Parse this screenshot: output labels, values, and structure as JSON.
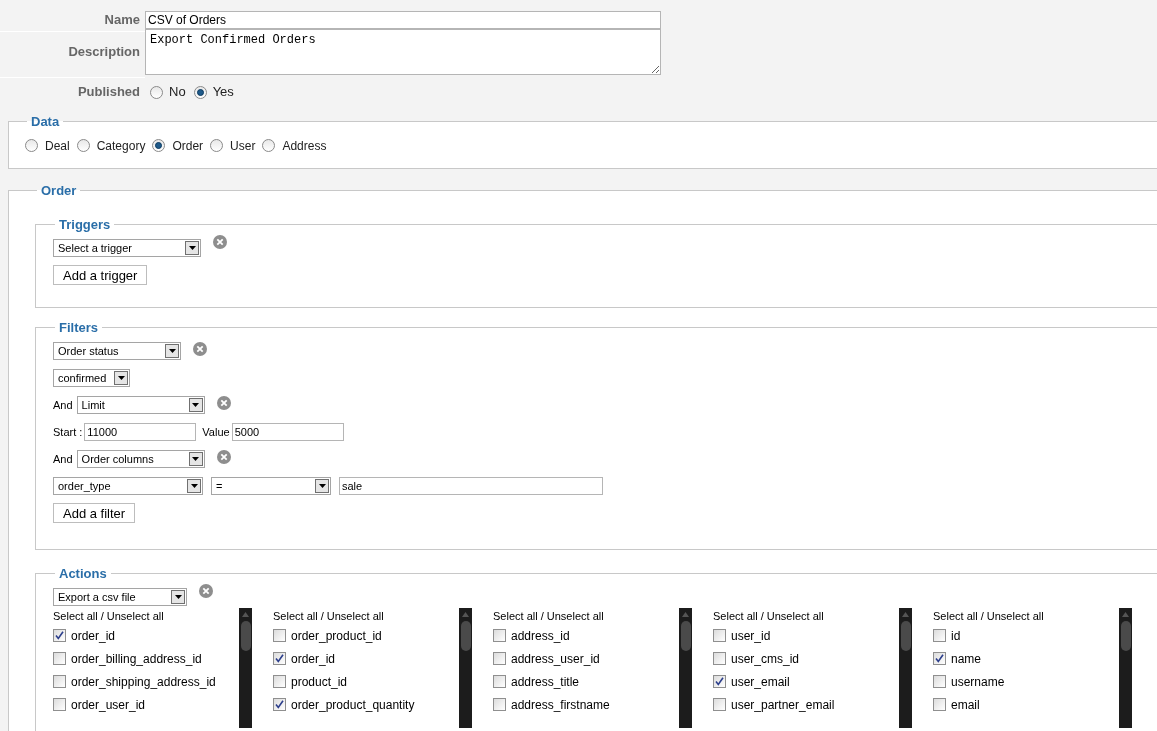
{
  "form": {
    "name": {
      "label": "Name",
      "value": "CSV of Orders"
    },
    "description": {
      "label": "Description",
      "value": "Export Confirmed Orders"
    },
    "published": {
      "label": "Published",
      "options": [
        {
          "label": "No",
          "selected": false
        },
        {
          "label": "Yes",
          "selected": true
        }
      ]
    }
  },
  "data": {
    "legend": "Data",
    "options": [
      {
        "label": "Deal",
        "selected": false
      },
      {
        "label": "Category",
        "selected": false
      },
      {
        "label": "Order",
        "selected": true
      },
      {
        "label": "User",
        "selected": false
      },
      {
        "label": "Address",
        "selected": false
      }
    ]
  },
  "order": {
    "legend": "Order",
    "triggers": {
      "legend": "Triggers",
      "select": "Select a trigger",
      "button": "Add a trigger"
    },
    "filters": {
      "legend": "Filters",
      "rows": [
        {
          "kind": "select",
          "select": "Order status",
          "removable": true
        },
        {
          "kind": "select",
          "select": "confirmed",
          "removable": false
        },
        {
          "kind": "select",
          "prefix": "And",
          "select": "Limit",
          "removable": true
        },
        {
          "kind": "range",
          "start_label": "Start :",
          "start": "11000",
          "value_label": "Value",
          "value": "5000"
        },
        {
          "kind": "select",
          "prefix": "And",
          "select": "Order columns",
          "removable": true
        },
        {
          "kind": "condition",
          "column": "order_type",
          "operator": "=",
          "value": "sale"
        }
      ],
      "button": "Add a filter"
    },
    "actions": {
      "legend": "Actions",
      "select": "Export a csv file",
      "columns": [
        {
          "select_all": "Select all / Unselect all",
          "items": [
            {
              "label": "order_id",
              "checked": true
            },
            {
              "label": "order_billing_address_id",
              "checked": false
            },
            {
              "label": "order_shipping_address_id",
              "checked": false
            },
            {
              "label": "order_user_id",
              "checked": false
            }
          ]
        },
        {
          "select_all": "Select all / Unselect all",
          "items": [
            {
              "label": "order_product_id",
              "checked": false
            },
            {
              "label": "order_id",
              "checked": true
            },
            {
              "label": "product_id",
              "checked": false
            },
            {
              "label": "order_product_quantity",
              "checked": true
            }
          ]
        },
        {
          "select_all": "Select all / Unselect all",
          "items": [
            {
              "label": "address_id",
              "checked": false
            },
            {
              "label": "address_user_id",
              "checked": false
            },
            {
              "label": "address_title",
              "checked": false
            },
            {
              "label": "address_firstname",
              "checked": false
            }
          ]
        },
        {
          "select_all": "Select all / Unselect all",
          "items": [
            {
              "label": "user_id",
              "checked": false
            },
            {
              "label": "user_cms_id",
              "checked": false
            },
            {
              "label": "user_email",
              "checked": true
            },
            {
              "label": "user_partner_email",
              "checked": false
            }
          ]
        },
        {
          "select_all": "Select all / Unselect all",
          "items": [
            {
              "label": "id",
              "checked": false
            },
            {
              "label": "name",
              "checked": true
            },
            {
              "label": "username",
              "checked": false
            },
            {
              "label": "email",
              "checked": false
            }
          ]
        }
      ]
    }
  }
}
